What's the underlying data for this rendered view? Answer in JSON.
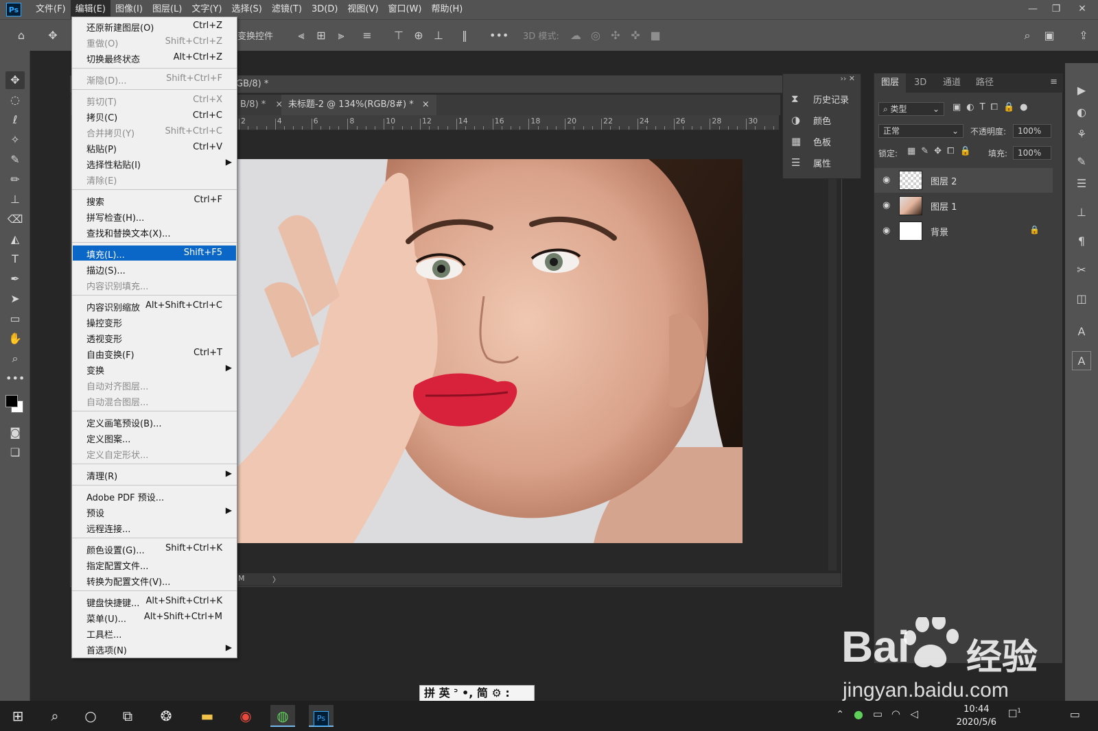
{
  "app": {
    "logo": "Ps",
    "menubar": [
      "文件(F)",
      "编辑(E)",
      "图像(I)",
      "图层(L)",
      "文字(Y)",
      "选择(S)",
      "滤镜(T)",
      "3D(D)",
      "视图(V)",
      "窗口(W)",
      "帮助(H)"
    ],
    "active_menu": "编辑(E)"
  },
  "options_bar": {
    "transform_label": "变换控件",
    "mode3d_label": "3D 模式:"
  },
  "document": {
    "window_title": "GB/8) *",
    "tabs": [
      {
        "label": "B/8) *",
        "close": "×"
      },
      {
        "label": "未标题-2 @ 134%(RGB/8#) *",
        "close": "×"
      }
    ],
    "ruler_labels": [
      "2",
      "4",
      "6",
      "8",
      "10",
      "12",
      "14",
      "16",
      "18",
      "20",
      "22",
      "24",
      "26",
      "28",
      "30"
    ],
    "status_text": "M",
    "status_arrow": "〉"
  },
  "mini_panel": {
    "items": [
      {
        "icon": "history-icon",
        "label": "历史记录"
      },
      {
        "icon": "color-palette-icon",
        "label": "颜色"
      },
      {
        "icon": "swatches-grid-icon",
        "label": "色板"
      },
      {
        "icon": "properties-icon",
        "label": "属性"
      }
    ]
  },
  "layers_panel": {
    "tabs": [
      "图层",
      "3D",
      "通道",
      "路径"
    ],
    "filter_label": "类型",
    "blend_mode": "正常",
    "opacity_label": "不透明度:",
    "opacity_value": "100%",
    "lock_label": "锁定:",
    "fill_label": "填充:",
    "fill_value": "100%",
    "layers": [
      {
        "name": "图层 2",
        "selected": true
      },
      {
        "name": "图层 1",
        "selected": false
      },
      {
        "name": "背景",
        "selected": false,
        "locked": true
      }
    ]
  },
  "edit_menu": {
    "items": [
      {
        "label": "还原新建图层(O)",
        "shortcut": "Ctrl+Z",
        "disabled": false
      },
      {
        "label": "重做(O)",
        "shortcut": "Shift+Ctrl+Z",
        "disabled": true
      },
      {
        "label": "切换最终状态",
        "shortcut": "Alt+Ctrl+Z",
        "disabled": false
      },
      {
        "label": "渐隐(D)...",
        "shortcut": "Shift+Ctrl+F",
        "disabled": true
      },
      {
        "label": "剪切(T)",
        "shortcut": "Ctrl+X",
        "disabled": true
      },
      {
        "label": "拷贝(C)",
        "shortcut": "Ctrl+C",
        "disabled": false
      },
      {
        "label": "合并拷贝(Y)",
        "shortcut": "Shift+Ctrl+C",
        "disabled": true
      },
      {
        "label": "粘贴(P)",
        "shortcut": "Ctrl+V",
        "disabled": false
      },
      {
        "label": "选择性粘贴(I)",
        "shortcut": "",
        "disabled": false,
        "submenu": true
      },
      {
        "label": "清除(E)",
        "shortcut": "",
        "disabled": true
      },
      {
        "label": "搜索",
        "shortcut": "Ctrl+F",
        "disabled": false
      },
      {
        "label": "拼写检查(H)...",
        "shortcut": "",
        "disabled": false
      },
      {
        "label": "查找和替换文本(X)...",
        "shortcut": "",
        "disabled": false
      },
      {
        "label": "填充(L)...",
        "shortcut": "Shift+F5",
        "disabled": false,
        "highlighted": true
      },
      {
        "label": "描边(S)...",
        "shortcut": "",
        "disabled": false
      },
      {
        "label": "内容识别填充...",
        "shortcut": "",
        "disabled": true
      },
      {
        "label": "内容识别缩放",
        "shortcut": "Alt+Shift+Ctrl+C",
        "disabled": false
      },
      {
        "label": "操控变形",
        "shortcut": "",
        "disabled": false
      },
      {
        "label": "透视变形",
        "shortcut": "",
        "disabled": false
      },
      {
        "label": "自由变换(F)",
        "shortcut": "Ctrl+T",
        "disabled": false
      },
      {
        "label": "变换",
        "shortcut": "",
        "disabled": false,
        "submenu": true
      },
      {
        "label": "自动对齐图层...",
        "shortcut": "",
        "disabled": true
      },
      {
        "label": "自动混合图层...",
        "shortcut": "",
        "disabled": true
      },
      {
        "label": "定义画笔预设(B)...",
        "shortcut": "",
        "disabled": false
      },
      {
        "label": "定义图案...",
        "shortcut": "",
        "disabled": false
      },
      {
        "label": "定义自定形状...",
        "shortcut": "",
        "disabled": true
      },
      {
        "label": "清理(R)",
        "shortcut": "",
        "disabled": false,
        "submenu": true
      },
      {
        "label": "Adobe PDF 预设...",
        "shortcut": "",
        "disabled": false
      },
      {
        "label": "预设",
        "shortcut": "",
        "disabled": false,
        "submenu": true
      },
      {
        "label": "远程连接...",
        "shortcut": "",
        "disabled": false
      },
      {
        "label": "颜色设置(G)...",
        "shortcut": "Shift+Ctrl+K",
        "disabled": false
      },
      {
        "label": "指定配置文件...",
        "shortcut": "",
        "disabled": false
      },
      {
        "label": "转换为配置文件(V)...",
        "shortcut": "",
        "disabled": false
      },
      {
        "label": "键盘快捷键...",
        "shortcut": "Alt+Shift+Ctrl+K",
        "disabled": false
      },
      {
        "label": "菜单(U)...",
        "shortcut": "Alt+Shift+Ctrl+M",
        "disabled": false
      },
      {
        "label": "工具栏...",
        "shortcut": "",
        "disabled": false
      },
      {
        "label": "首选项(N)",
        "shortcut": "",
        "disabled": false,
        "submenu": true
      }
    ]
  },
  "ime_bar": {
    "text": "拼 英 ᐣ •, 简 ⚙ :"
  },
  "taskbar": {
    "clock_time": "10:44",
    "clock_date": "2020/5/6",
    "notification_count": "1"
  },
  "watermark": {
    "brand": "Bai",
    "brand2": "经验",
    "url": "jingyan.baidu.com"
  },
  "colors": {
    "menu_highlight": "#0a66c7",
    "ps_blue": "#31a8ff",
    "panel_bg": "#3d3d3d"
  }
}
